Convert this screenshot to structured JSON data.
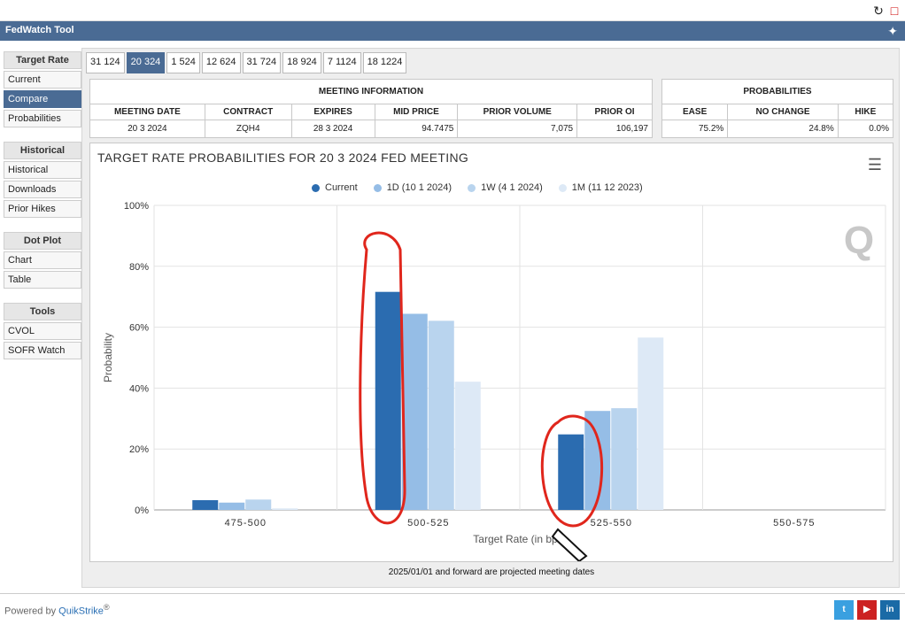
{
  "app": {
    "title": "FedWatch Tool"
  },
  "sidebar": {
    "sections": [
      {
        "title": "Target Rate",
        "items": [
          "Current",
          "Compare",
          "Probabilities"
        ]
      },
      {
        "title": "Historical",
        "items": [
          "Historical",
          "Downloads",
          "Prior Hikes"
        ]
      },
      {
        "title": "Dot Plot",
        "items": [
          "Chart",
          "Table"
        ]
      },
      {
        "title": "Tools",
        "items": [
          "CVOL",
          "SOFR Watch"
        ]
      }
    ],
    "active_item": "Compare"
  },
  "tabs": [
    "31 124",
    "20 324",
    "1 524",
    "12 624",
    "31 724",
    "18 924",
    "7 1124",
    "18 1224"
  ],
  "active_tab": "20 324",
  "meeting_info": {
    "heading": "MEETING INFORMATION",
    "columns": [
      "MEETING DATE",
      "CONTRACT",
      "EXPIRES",
      "MID PRICE",
      "PRIOR VOLUME",
      "PRIOR OI"
    ],
    "row": [
      "20 3 2024",
      "ZQH4",
      "28 3 2024",
      "94.7475",
      "7,075",
      "106,197"
    ]
  },
  "probabilities": {
    "heading": "PROBABILITIES",
    "columns": [
      "EASE",
      "NO CHANGE",
      "HIKE"
    ],
    "row": [
      "75.2%",
      "24.8%",
      "0.0%"
    ]
  },
  "chart_data": {
    "type": "bar",
    "title": "TARGET RATE PROBABILITIES FOR 20 3 2024 FED MEETING",
    "xlabel": "Target Rate (in bps)",
    "ylabel": "Probability",
    "categories": [
      "475-500",
      "500-525",
      "525-550",
      "550-575"
    ],
    "ylim": [
      0,
      100
    ],
    "yticks": [
      "0%",
      "20%",
      "40%",
      "60%",
      "80%",
      "100%"
    ],
    "series": [
      {
        "name": "Current",
        "color": "#2b6cb0",
        "values": [
          3.2,
          71.6,
          24.8,
          0
        ]
      },
      {
        "name": "1D (10 1 2024)",
        "color": "#95bde6",
        "values": [
          2.4,
          64.4,
          32.5,
          0
        ]
      },
      {
        "name": "1W (4 1 2024)",
        "color": "#b9d4ee",
        "values": [
          3.4,
          62.1,
          33.4,
          0
        ]
      },
      {
        "name": "1M (11 12 2023)",
        "color": "#dde9f6",
        "values": [
          0.5,
          42.1,
          56.6,
          0
        ]
      }
    ],
    "grid": true,
    "legend": "top-center"
  },
  "footnote": "2025/01/01 and forward are projected meeting dates",
  "footer": {
    "powered_by": "Powered by",
    "brand": "QuikStrike"
  }
}
